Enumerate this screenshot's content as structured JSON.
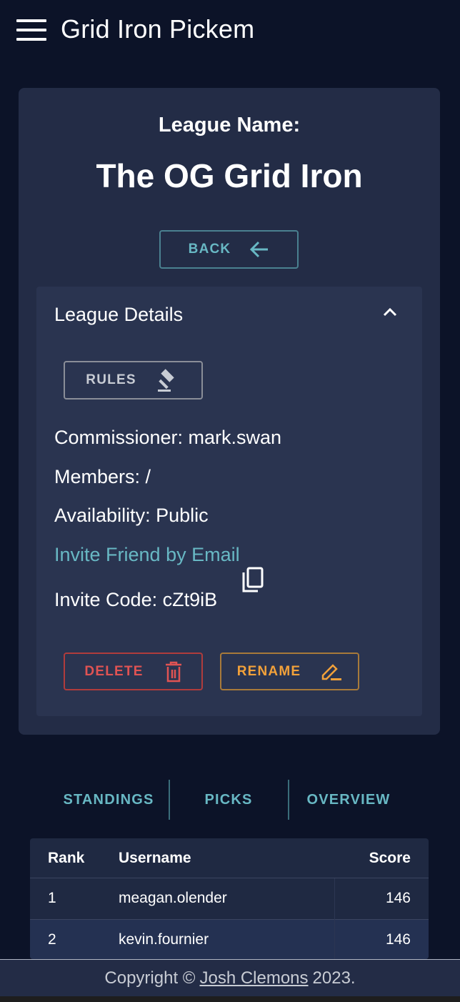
{
  "app": {
    "title": "Grid Iron Pickem"
  },
  "league": {
    "label": "League Name:",
    "name": "The OG Grid Iron",
    "back_label": "BACK"
  },
  "details": {
    "title": "League Details",
    "rules_label": "RULES",
    "commissioner": "Commissioner: mark.swan",
    "members": "Members: /",
    "availability": "Availability: Public",
    "invite_link": "Invite Friend by Email",
    "invite_code": "Invite Code: cZt9iB",
    "delete_label": "DELETE",
    "rename_label": "RENAME"
  },
  "tabs": [
    {
      "label": "STANDINGS"
    },
    {
      "label": "PICKS"
    },
    {
      "label": "OVERVIEW"
    }
  ],
  "standings": {
    "headers": {
      "rank": "Rank",
      "username": "Username",
      "score": "Score"
    },
    "rows": [
      {
        "rank": "1",
        "username": "meagan.olender",
        "score": "146"
      },
      {
        "rank": "2",
        "username": "kevin.fournier",
        "score": "146"
      }
    ]
  },
  "footer": {
    "prefix": "Copyright ©",
    "author": "Josh Clemons",
    "suffix": "2023."
  },
  "colors": {
    "background": "#0c1328",
    "card": "#232c46",
    "accent": "#68b8c4",
    "danger": "#e05353",
    "warning": "#f2a13a"
  }
}
